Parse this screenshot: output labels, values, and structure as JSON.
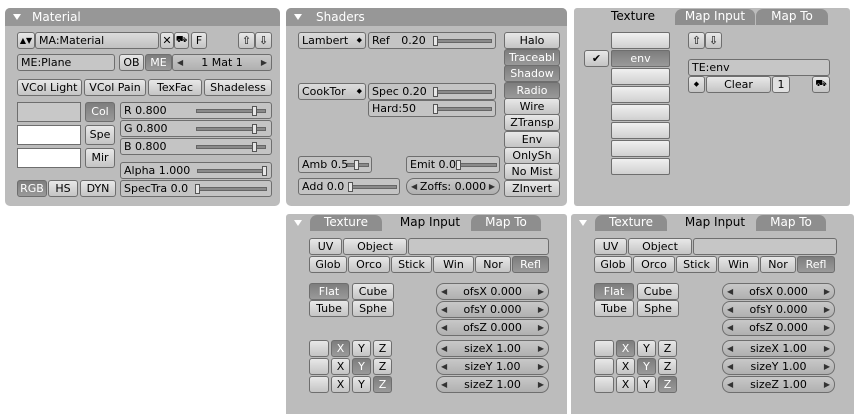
{
  "material": {
    "title": "Material",
    "name_field": "MA:Material",
    "close_glyph": "✕",
    "fake_user": "F",
    "mesh_field": "ME:Plane",
    "ob_button": "OB",
    "me_button": "ME",
    "slot_selector": "1 Mat 1",
    "mode_buttons": [
      "VCol Light",
      "VCol Pain",
      "TexFac",
      "Shadeless"
    ],
    "color_buttons": [
      "Col",
      "Spe",
      "Mir"
    ],
    "sliders": [
      {
        "label": "R 0.800",
        "value": 0.8
      },
      {
        "label": "G 0.800",
        "value": 0.8
      },
      {
        "label": "B 0.800",
        "value": 0.8
      }
    ],
    "alpha": {
      "label": "Alpha 1.000",
      "value": 1.0
    },
    "spectra": {
      "label": "SpecTra 0.0",
      "value": 0.0
    },
    "color_modes": [
      "RGB",
      "HS",
      "DYN"
    ]
  },
  "shaders": {
    "title": "Shaders",
    "diffuse_menu": "Lambert",
    "ref": {
      "label": "Ref",
      "value_text": "0.20",
      "value": 0.2
    },
    "spec_menu": "CookTor",
    "spec": {
      "label": "Spec 0.20",
      "value": 0.2
    },
    "hard": {
      "label": "Hard:50",
      "value": 0.1
    },
    "amb": {
      "label": "Amb 0.5",
      "value": 0.5
    },
    "emit": {
      "label": "Emit 0.0",
      "value": 0.0
    },
    "add": {
      "label": "Add 0.0",
      "value": 0.0
    },
    "zoffs": "Zoffs: 0.000",
    "toggles": [
      {
        "label": "Halo",
        "on": false
      },
      {
        "label": "Traceabl",
        "on": true
      },
      {
        "label": "Shadow",
        "on": true
      },
      {
        "label": "Radio",
        "on": true
      },
      {
        "label": "Wire",
        "on": false
      },
      {
        "label": "ZTransp",
        "on": false
      },
      {
        "label": "Env",
        "on": false
      },
      {
        "label": "OnlySh",
        "on": false
      },
      {
        "label": "No Mist",
        "on": false
      },
      {
        "label": "ZInvert",
        "on": false
      }
    ]
  },
  "texture_panel": {
    "tabs": [
      "Texture",
      "Map Input",
      "Map To"
    ],
    "checkmark": "✔",
    "selected_slot": "env",
    "te_field": "TE:env",
    "clear_button": "Clear",
    "users_count": "1"
  },
  "map_input": {
    "tabs": [
      "Texture",
      "Map Input",
      "Map To"
    ],
    "row1": [
      "UV",
      "Object"
    ],
    "coords": [
      "Glob",
      "Orco",
      "Stick",
      "Win",
      "Nor",
      "Refl"
    ],
    "active_coord": "Refl",
    "proj": [
      "Flat",
      "Cube",
      "Tube",
      "Sphe"
    ],
    "active_proj": "Flat",
    "offsets": [
      "ofsX 0.000",
      "ofsY 0.000",
      "ofsZ 0.000"
    ],
    "axis_labels": [
      "X",
      "Y",
      "Z"
    ],
    "sizes": [
      "sizeX 1.00",
      "sizeY 1.00",
      "sizeZ 1.00"
    ]
  }
}
